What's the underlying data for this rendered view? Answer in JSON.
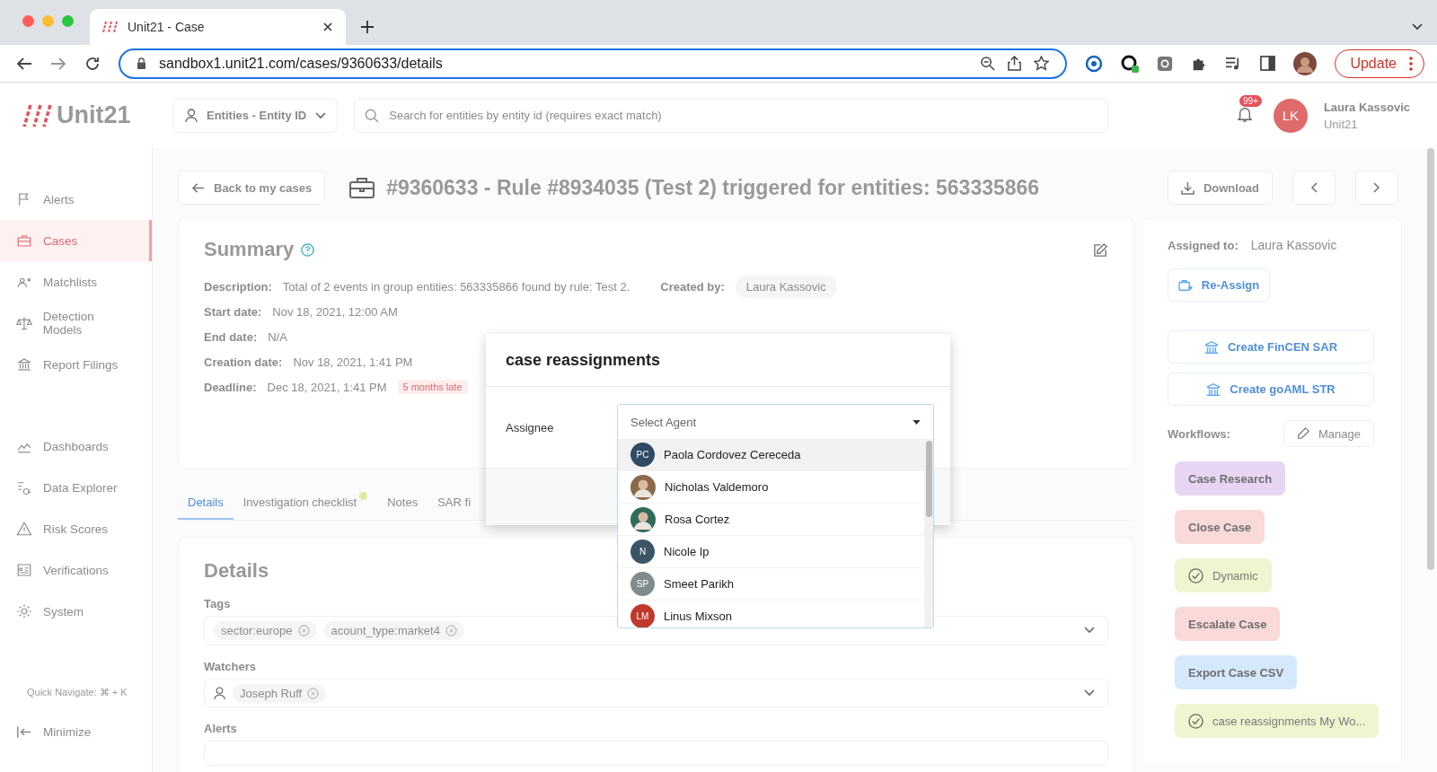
{
  "browser": {
    "tab_title": "Unit21 - Case",
    "url": "sandbox1.unit21.com/cases/9360633/details",
    "update_button": "Update"
  },
  "header": {
    "logo": "Unit21",
    "entity_select": "Entities - Entity ID",
    "search_placeholder": "Search for entities by entity id (requires exact match)",
    "notification_badge": "99+",
    "user": {
      "initials": "LK",
      "name": "Laura Kassovic",
      "org": "Unit21"
    }
  },
  "sidebar": {
    "groups": [
      [
        {
          "label": "Alerts",
          "selected": false
        },
        {
          "label": "Cases",
          "selected": true
        },
        {
          "label": "Matchlists",
          "selected": false
        },
        {
          "label": "Detection Models",
          "selected": false
        },
        {
          "label": "Report Filings",
          "selected": false
        }
      ],
      [
        {
          "label": "Dashboards",
          "selected": false
        },
        {
          "label": "Data Explorer",
          "selected": false
        },
        {
          "label": "Risk Scores",
          "selected": false
        },
        {
          "label": "Verifications",
          "selected": false
        },
        {
          "label": "System",
          "selected": false
        }
      ]
    ],
    "quick_navigate": "Quick Navigate: ⌘ + K",
    "minimize": "Minimize"
  },
  "title_bar": {
    "back_button": "Back to my cases",
    "title": "#9360633 - Rule #8934035 (Test 2) triggered for entities: 563335866",
    "download_button": "Download"
  },
  "summary": {
    "title": "Summary",
    "fields": [
      {
        "label": "Description:",
        "value": "Total of 2 events in group entities: 563335866 found by rule: Test 2.",
        "created_by_label": "Created by:",
        "created_by": "Laura Kassovic"
      },
      {
        "label": "Start date:",
        "value": "Nov 18, 2021, 12:00 AM"
      },
      {
        "label": "End date:",
        "value": "N/A"
      },
      {
        "label": "Creation date:",
        "value": "Nov 18, 2021, 1:41 PM"
      },
      {
        "label": "Deadline:",
        "value": "Dec 18, 2021, 1:41 PM",
        "badge": "5 months late"
      }
    ]
  },
  "tabs": [
    {
      "label": "Details",
      "selected": true,
      "indicator": false
    },
    {
      "label": "Investigation checklist",
      "selected": false,
      "indicator": true
    },
    {
      "label": "Notes",
      "selected": false,
      "indicator": false
    },
    {
      "label": "SAR fi",
      "selected": false,
      "indicator": false
    }
  ],
  "details": {
    "title": "Details",
    "tags": {
      "label": "Tags",
      "chips": [
        "sector:europe",
        "acount_type:market4"
      ]
    },
    "watchers": {
      "label": "Watchers",
      "chips": [
        "Joseph Ruff"
      ]
    },
    "alerts": {
      "label": "Alerts"
    }
  },
  "right_panel": {
    "assigned_label": "Assigned to:",
    "assigned_value": "Laura Kassovic",
    "reassign_button": "Re-Assign",
    "fincen_button": "Create FinCEN SAR",
    "goaml_button": "Create goAML STR",
    "workflows_label": "Workflows:",
    "manage_button": "Manage",
    "workflows": [
      {
        "label": "Case Research",
        "color": "#e8d5f3",
        "kind": "plain"
      },
      {
        "label": "Close Case",
        "color": "#fad9d9",
        "kind": "plain"
      },
      {
        "label": "Dynamic",
        "color": "#eef6d0",
        "kind": "check"
      },
      {
        "label": "Escalate Case",
        "color": "#fad9d9",
        "kind": "plain"
      },
      {
        "label": "Export Case CSV",
        "color": "#d5e8fc",
        "kind": "plain"
      },
      {
        "label": "case reassignments My Wo...",
        "color": "#eef6d0",
        "kind": "check"
      }
    ]
  },
  "modal": {
    "title": "case reassignments",
    "assignee_label": "Assignee",
    "select_placeholder": "Select Agent",
    "agents": [
      {
        "name": "Paola Cordovez Cereceda",
        "initials": "PC",
        "kind": "initials",
        "color": "#2f4a63",
        "selected": true
      },
      {
        "name": "Nicholas Valdemoro",
        "kind": "photo",
        "color": "#8a6a4a",
        "selected": false
      },
      {
        "name": "Rosa Cortez",
        "kind": "photo",
        "color": "#2f6b5a",
        "selected": false
      },
      {
        "name": "Nicole Ip",
        "initials": "N",
        "kind": "initials",
        "color": "#3b5466",
        "selected": false
      },
      {
        "name": "Smeet Parikh",
        "initials": "SP",
        "kind": "initials",
        "color": "#7f8c8d",
        "selected": false
      },
      {
        "name": "Linus Mixson",
        "initials": "LM",
        "kind": "initials",
        "color": "#c0392b",
        "selected": false
      }
    ]
  }
}
